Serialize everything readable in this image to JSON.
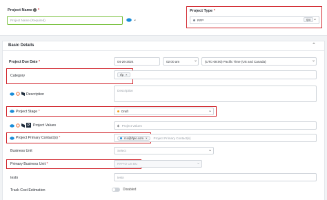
{
  "colors": {
    "accent": "#1a8cd8",
    "highlight": "#d1232a",
    "success": "#7cc242",
    "draft": "#f0a020"
  },
  "project_name": {
    "label": "Project Name",
    "required_mark": "*",
    "placeholder": "Project Name (Required)"
  },
  "project_type": {
    "label": "Project Type",
    "required_mark": "*",
    "value": "RFP",
    "chip": "rpo"
  },
  "section": {
    "title": "Basic Details",
    "collapse_icon": "chevron-up-icon"
  },
  "due_date": {
    "label": "Project Due Date",
    "required_mark": "*",
    "date": "04-26-2024",
    "time": "02:00 am",
    "timezone": "(UTC-08:00) Pacific Time (US and Canada)"
  },
  "category": {
    "label": "Category",
    "chip": "rfp"
  },
  "description": {
    "label": "Description",
    "placeholder": "Description"
  },
  "stage": {
    "label": "Project Stage",
    "required_mark": "*",
    "value": "Draft"
  },
  "values": {
    "label": "Project Values",
    "currency": "$",
    "placeholder": "Project Values"
  },
  "primary_contact": {
    "label": "Project Primary Contact(s)",
    "required_mark": "*",
    "chip": "rco@rfpio.com",
    "placeholder": "Project Primary Contact(s)"
  },
  "business_unit": {
    "label": "Business Unit",
    "placeholder": "Select"
  },
  "primary_bu": {
    "label": "Primary Business Unit",
    "required_mark": "*",
    "value": "RFPIO US BU"
  },
  "testn": {
    "label": "testn",
    "placeholder": "testn"
  },
  "track_cost": {
    "label": "Track Cost Estimation",
    "value": "Disabled"
  }
}
